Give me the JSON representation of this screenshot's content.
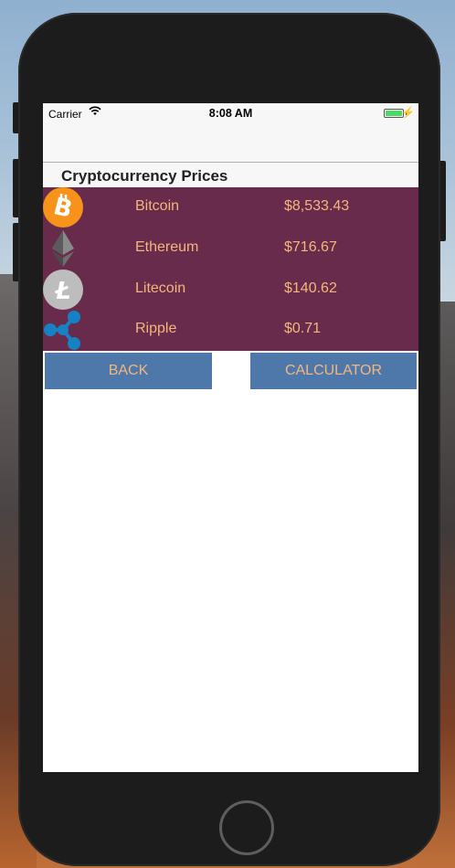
{
  "status_bar": {
    "carrier": "Carrier",
    "time": "8:08 AM"
  },
  "section": {
    "title": "Cryptocurrency Prices"
  },
  "coins": [
    {
      "name": "Bitcoin",
      "price": "$8,533.43",
      "icon": "bitcoin-icon"
    },
    {
      "name": "Ethereum",
      "price": "$716.67",
      "icon": "ethereum-icon"
    },
    {
      "name": "Litecoin",
      "price": "$140.62",
      "icon": "litecoin-icon"
    },
    {
      "name": "Ripple",
      "price": "$0.71",
      "icon": "ripple-icon"
    }
  ],
  "buttons": {
    "back": "BACK",
    "calculator": "CALCULATOR"
  },
  "colors": {
    "table_bg": "#692b4b",
    "text_accent": "#f3b77d",
    "button_bg": "#4e78aa"
  }
}
